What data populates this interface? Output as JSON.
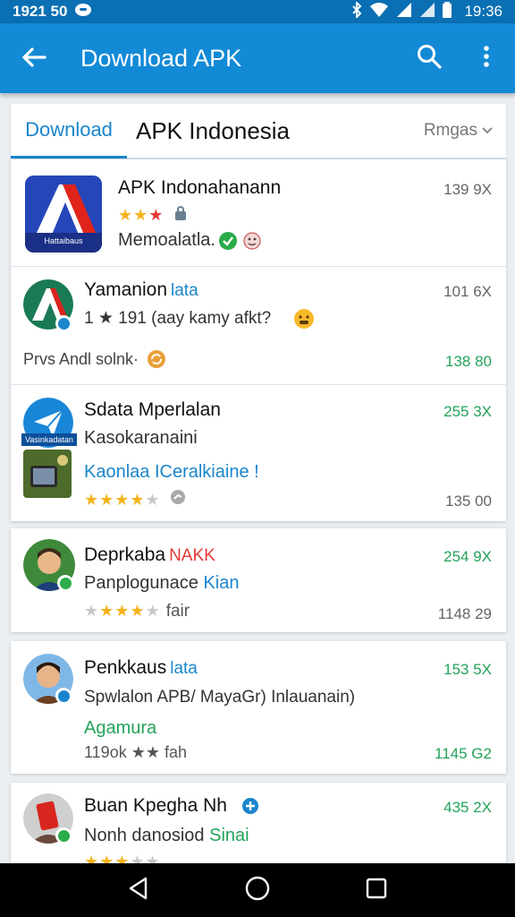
{
  "status_bar": {
    "time": "1921 50",
    "clock": "19:36",
    "icons": [
      "messenger-icon",
      "bluetooth-icon",
      "wifi-icon",
      "signal-icon",
      "battery-icon"
    ]
  },
  "app_bar": {
    "title": "Download APK",
    "icons": [
      "back-arrow-icon",
      "search-icon",
      "more-vert-icon"
    ]
  },
  "tabs": {
    "active": "Download",
    "title": "APK Indonesia",
    "sort_label": "Rmgas"
  },
  "apps": [
    {
      "name": "APK Indonahanann",
      "size": "139 9X",
      "stars": 2,
      "subtitle": "Memoalatla.",
      "icon_caption": "Hattaibaus"
    },
    {
      "name": "Yamanion",
      "name_tag": "lata",
      "size": "101 6X",
      "rating_text": "1 ★ 191 (aay kamy afkt?",
      "extra": "Prvs Andl solnk·",
      "price": "138 80"
    },
    {
      "name": "Sdata Mperlalan",
      "size": "255 3X",
      "subtitle": "Kasokaranaini",
      "highlight": "Kaonlaa ICeralkiaine !",
      "stars": 4,
      "price": "135 00",
      "icon_caption": "Vasinkadatan"
    },
    {
      "name": "Deprkaba",
      "name_tag": "NAKK",
      "size": "254 9X",
      "subtitle": "Panplogunace",
      "subtitle_tag": "Kian",
      "stars": 4,
      "rating_text": "fair",
      "price": "1148 29"
    },
    {
      "name": "Penkkaus",
      "name_tag": "lata",
      "size": "153 5X",
      "subtitle": "Spwlalon APB/ MayaGr)  Inlauanain)",
      "highlight": "Agamura",
      "rating_text": "119ok ★★ fah",
      "price": "1145 G2"
    },
    {
      "name": "Buan Kpegha Nh",
      "size": "435 2X",
      "subtitle": "Nonh danosiod",
      "subtitle_tag": "Sinai"
    }
  ],
  "colors": {
    "status_bar": "#0a6fb3",
    "app_bar": "#138ad6",
    "accent": "#1a85cc",
    "green": "#23a25a",
    "star": "#f5b21b",
    "red": "#e53935"
  },
  "nav": {
    "icons": [
      "back-triangle-icon",
      "home-circle-icon",
      "recents-square-icon"
    ]
  }
}
